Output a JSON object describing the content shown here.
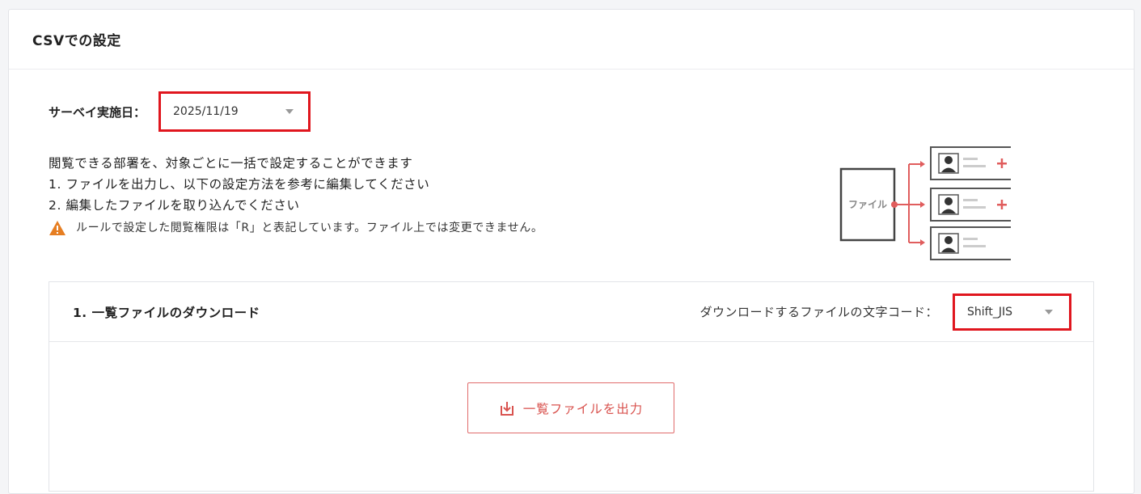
{
  "card": {
    "title": "CSVでの設定"
  },
  "survey": {
    "label": "サーベイ実施日：",
    "date_value": "2025/11/19"
  },
  "description": {
    "line1": "閲覧できる部署を、対象ごとに一括で設定することができます",
    "line2": "1. ファイルを出力し、以下の設定方法を参考に編集してください",
    "line3": "2. 編集したファイルを取り込んでください",
    "warning": "ルールで設定した閲覧権限は「R」と表記しています。ファイル上では変更できません。"
  },
  "illustration": {
    "file_label": "ファイル"
  },
  "download_section": {
    "title": "1. 一覧ファイルのダウンロード",
    "encoding_label": "ダウンロードするファイルの文字コード：",
    "encoding_value": "Shift_JIS",
    "export_button": "一覧ファイルを出力"
  },
  "colors": {
    "accent": "#d9534f",
    "highlight": "#e0161e",
    "warning": "#e67e22"
  },
  "icons": [
    "warning-icon",
    "caret-down-icon",
    "download-icon"
  ]
}
